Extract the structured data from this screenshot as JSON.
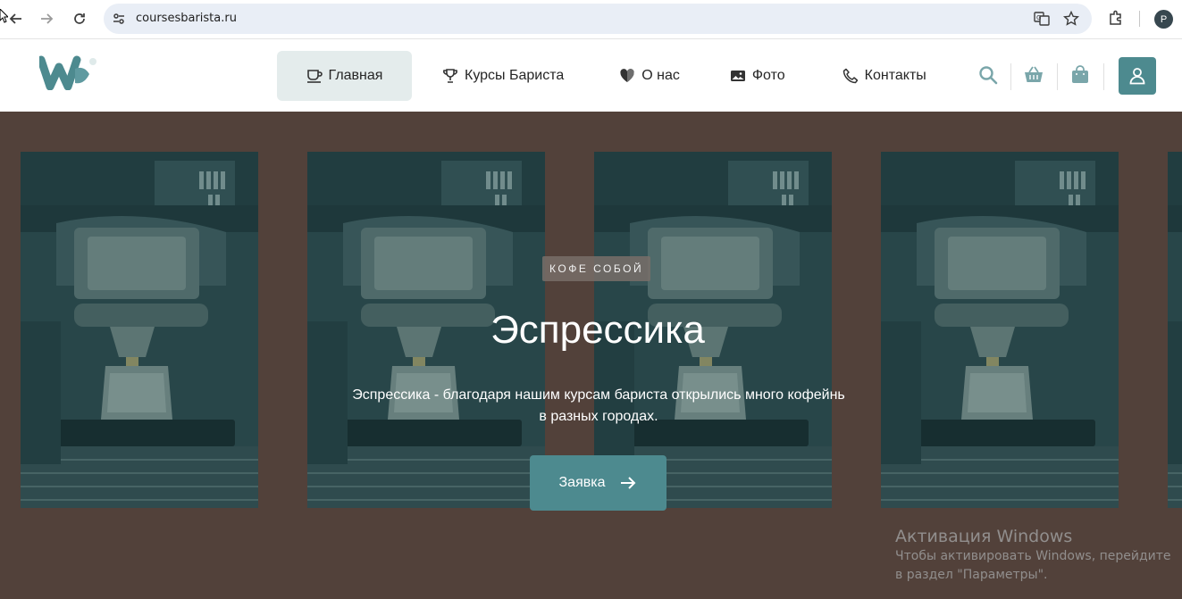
{
  "browser": {
    "url": "coursesbarista.ru",
    "profile_initial": "P"
  },
  "site": {
    "menu": [
      {
        "label": "Главная",
        "icon": "cup-icon",
        "active": true
      },
      {
        "label": "Курсы Бариста",
        "icon": "trophy-icon",
        "active": false
      },
      {
        "label": "О нас",
        "icon": "heart-icon",
        "active": false
      },
      {
        "label": "Фото",
        "icon": "image-icon",
        "active": false
      },
      {
        "label": "Контакты",
        "icon": "phone-icon",
        "active": false
      }
    ],
    "header_icons": [
      "search-icon",
      "basket-icon",
      "bag-icon",
      "user-icon"
    ]
  },
  "hero": {
    "badge": "КОФЕ СОБОЙ",
    "title": "Эспрессика",
    "text": "Эспрессика - благодаря нашим курсам бариста открылись много кофейнь в разных городах.",
    "cta_label": "Заявка"
  },
  "watermark": {
    "title": "Активация Windows",
    "text": "Чтобы активировать Windows, перейдите в раздел \"Параметры\"."
  },
  "colors": {
    "accent": "#4d8a8f",
    "hero_bg": "#52413a",
    "active_menu_bg": "#e4ecec"
  }
}
